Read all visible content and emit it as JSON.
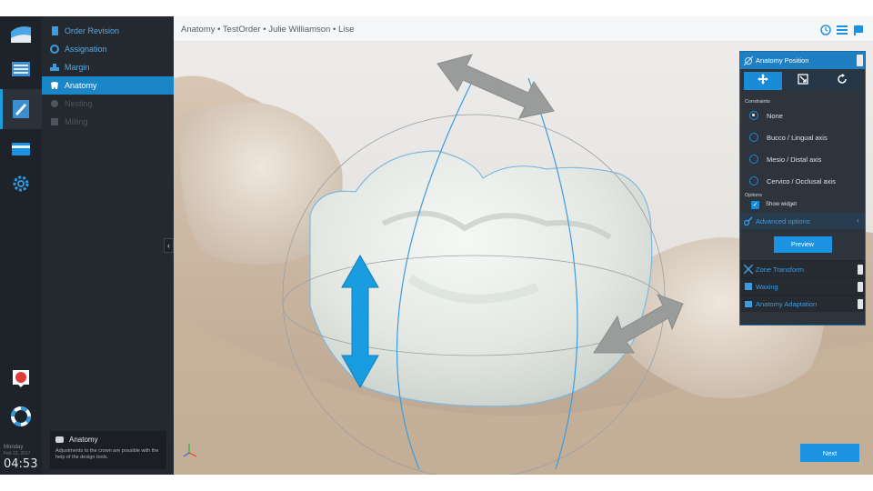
{
  "breadcrumb": "Anatomy • TestOrder • Julie Williamson • Lise",
  "nav": {
    "items": [
      {
        "label": "Order Revision",
        "state": "done"
      },
      {
        "label": "Assignation",
        "state": "done"
      },
      {
        "label": "Margin",
        "state": "done"
      },
      {
        "label": "Anatomy",
        "state": "active"
      },
      {
        "label": "Nesting",
        "state": "disabled"
      },
      {
        "label": "Milling",
        "state": "disabled"
      }
    ]
  },
  "help_card": {
    "title": "Anatomy",
    "description": "Adjustments to the crown are possible with the help of the design tools."
  },
  "clock": {
    "day": "Monday",
    "date": "Feb 13, 2017",
    "time": "04:53"
  },
  "panel": {
    "title": "Anatomy Position",
    "modes": [
      "move-icon",
      "scale-icon",
      "rotate-icon"
    ],
    "active_mode": 0,
    "constraints_label": "Constraints",
    "constraints": [
      "None",
      "Bucco / Lingual axis",
      "Mesio / Distal axis",
      "Cervico / Occlusal axis"
    ],
    "selected_constraint": 0,
    "options_label": "Options",
    "show_widget_label": "Show widget",
    "show_widget": true,
    "advanced_label": "Advanced options",
    "preview_label": "Preview",
    "sections": [
      "Zone Transform",
      "Waxing",
      "Anatomy Adaptation"
    ]
  },
  "next_label": "Next",
  "colors": {
    "accent": "#1a93e3",
    "sidebar": "#24292f",
    "rail": "#1e2329",
    "tooth": "#e8ebe6",
    "gum": "#d9c7b8"
  }
}
